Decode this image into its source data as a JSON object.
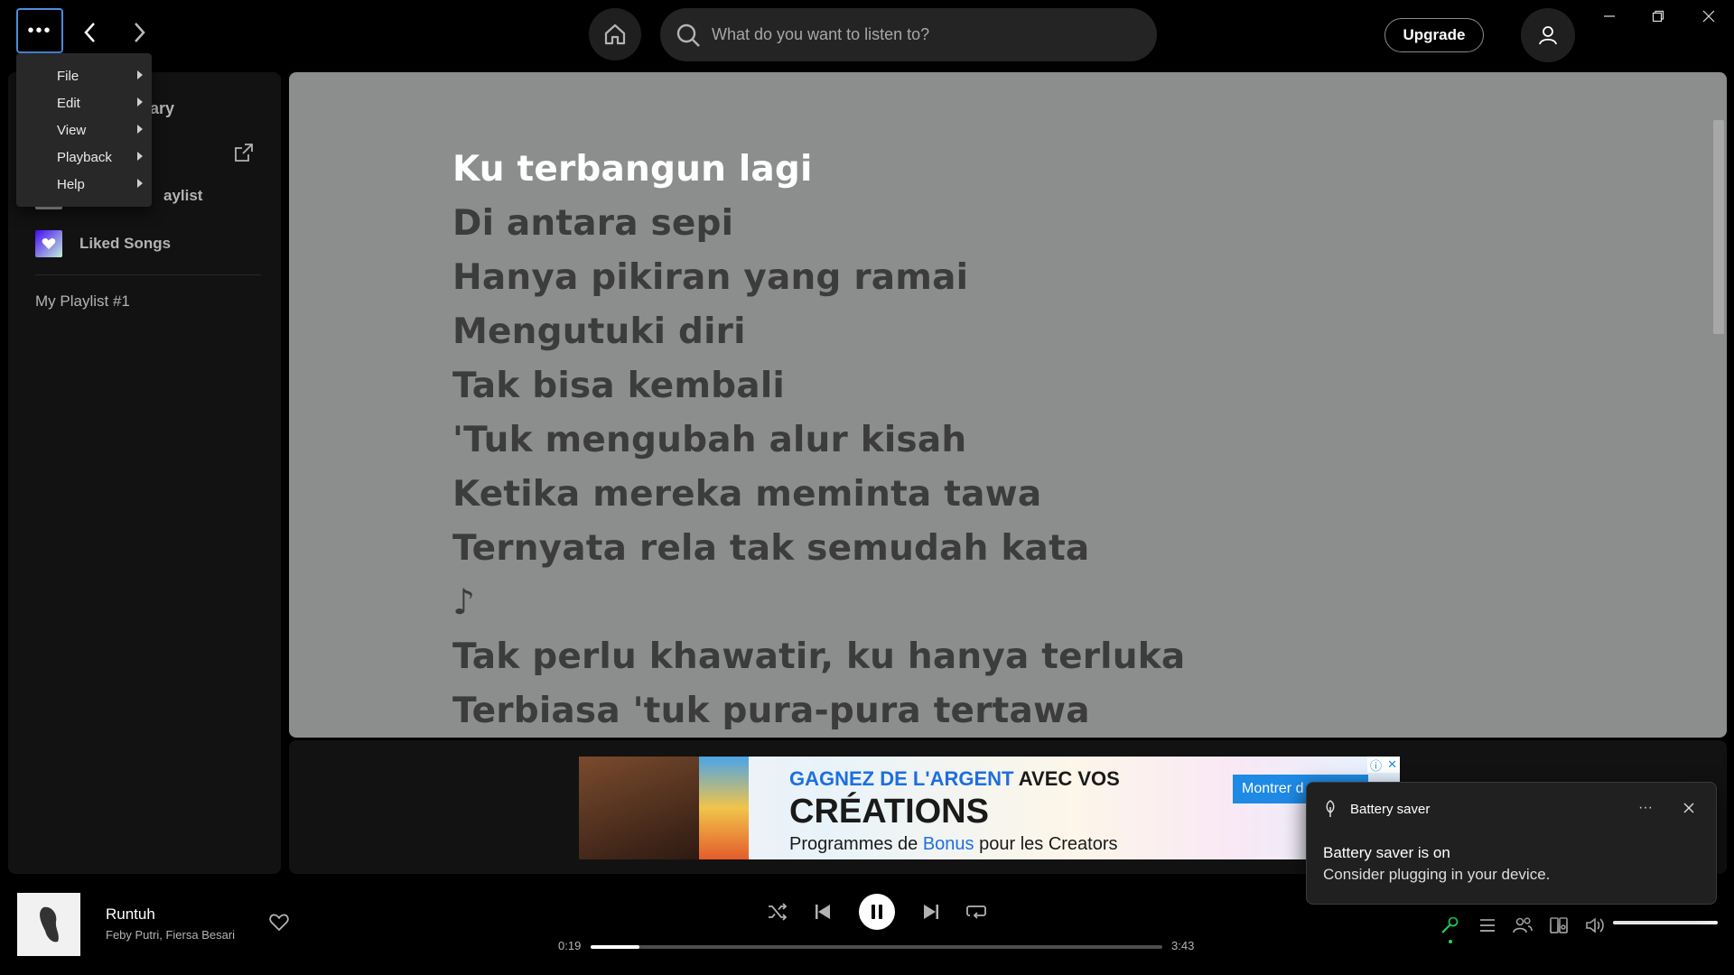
{
  "topbar": {
    "menu_icon": "more-dots-icon",
    "search_placeholder": "What do you want to listen to?",
    "upgrade_label": "Upgrade",
    "window_controls": [
      "minimize",
      "restore",
      "close"
    ]
  },
  "context_menu": {
    "items": [
      {
        "label": "File"
      },
      {
        "label": "Edit"
      },
      {
        "label": "View"
      },
      {
        "label": "Playback"
      },
      {
        "label": "Help"
      }
    ]
  },
  "sidebar": {
    "library_label_fragment": "ary",
    "create_playlist_fragment": "aylist",
    "liked_songs_label": "Liked Songs",
    "playlists": [
      "My Playlist #1"
    ]
  },
  "lyrics": {
    "lines": [
      "Ku terbangun lagi",
      "Di antara sepi",
      "Hanya pikiran yang ramai",
      "Mengutuki diri",
      "Tak bisa kembali",
      "'Tuk mengubah alur kisah",
      "Ketika mereka meminta tawa",
      "Ternyata rela tak semudah kata",
      "♪",
      "Tak perlu khawatir, ku hanya terluka",
      "Terbiasa 'tuk pura-pura tertawa"
    ],
    "active_index": 0,
    "active_color": "#ffffff",
    "inactive_color": "#3c3c3c",
    "background": "#8c8e8e"
  },
  "ad": {
    "line1_highlight": "GAGNEZ DE L'ARGENT",
    "line1_rest": " AVEC VOS",
    "line2": "CRÉATIONS",
    "line3_a": "Programmes de ",
    "line3_highlight": "Bonus",
    "line3_b": " pour les Creators",
    "cta": "Montrer d"
  },
  "toast": {
    "app_name": "Battery saver",
    "title": "Battery saver is on",
    "body": "Consider plugging in your device.",
    "more_label": "···"
  },
  "player": {
    "track_title": "Runtuh",
    "track_artist": "Feby Putri, Fiersa Besari",
    "elapsed": "0:19",
    "duration": "3:43",
    "progress_fraction": 0.085,
    "volume_fraction": 1.0,
    "accent_color": "#1ed760"
  }
}
